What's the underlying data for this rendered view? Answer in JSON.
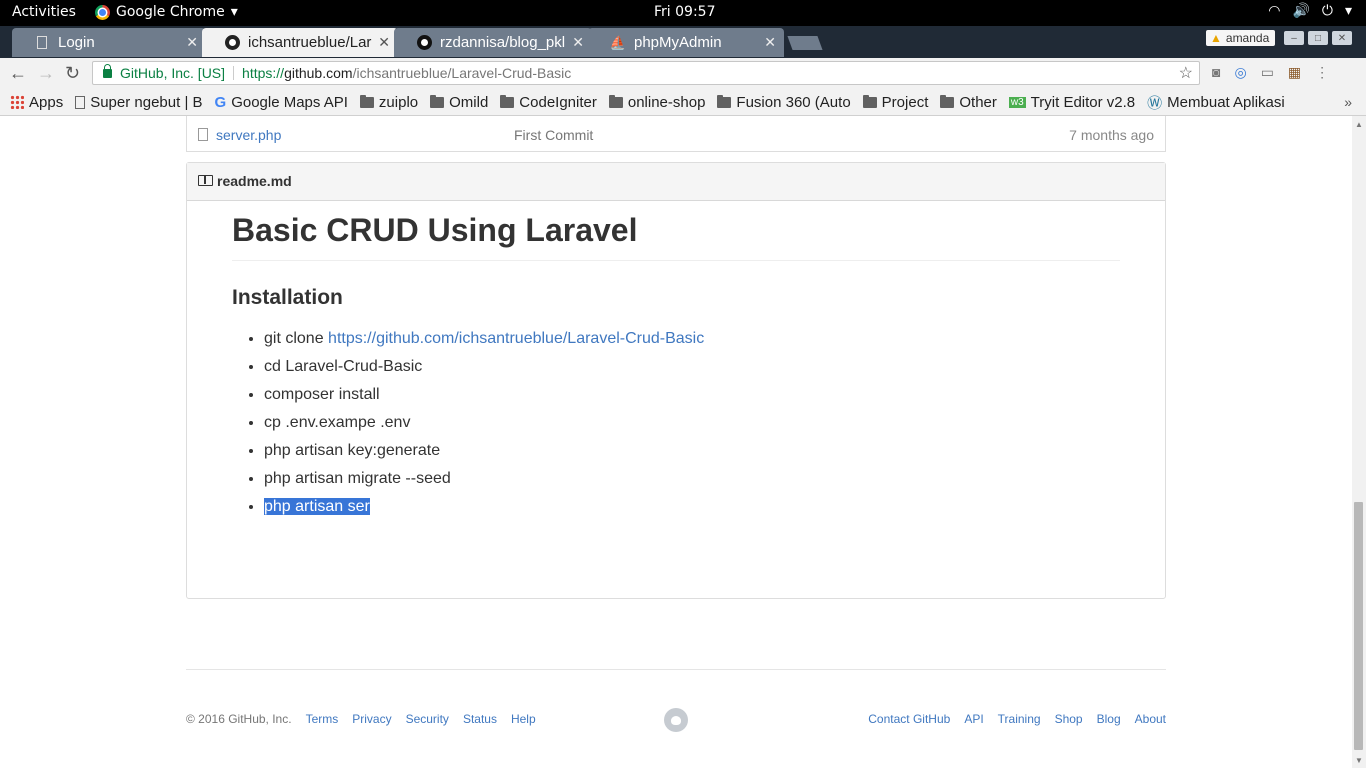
{
  "system_bar": {
    "activities": "Activities",
    "app_name": "Google Chrome",
    "clock": "Fri 09:57"
  },
  "tabs": [
    {
      "title": "Login",
      "active": false
    },
    {
      "title": "ichsantrueblue/Lara",
      "active": true
    },
    {
      "title": "rzdannisa/blog_pkl",
      "active": false
    },
    {
      "title": "phpMyAdmin",
      "active": false
    }
  ],
  "profile": {
    "name": "amanda"
  },
  "address_bar": {
    "ev_label": "GitHub, Inc. [US]",
    "url_protocol": "https://",
    "url_host": "github.com",
    "url_path": "/ichsantrueblue/Laravel-Crud-Basic"
  },
  "bookmarks": [
    {
      "label": "Apps",
      "icon": "apps-icon"
    },
    {
      "label": "Super ngebut | B",
      "icon": "page-icon"
    },
    {
      "label": "Google Maps API",
      "icon": "google-icon"
    },
    {
      "label": "zuiplo",
      "icon": "folder-icon"
    },
    {
      "label": "Omild",
      "icon": "folder-icon"
    },
    {
      "label": "CodeIgniter",
      "icon": "folder-icon"
    },
    {
      "label": "online-shop",
      "icon": "folder-icon"
    },
    {
      "label": "Fusion 360 (Auto",
      "icon": "folder-icon"
    },
    {
      "label": "Project",
      "icon": "folder-icon"
    },
    {
      "label": "Other",
      "icon": "folder-icon"
    },
    {
      "label": "Tryit Editor v2.8",
      "icon": "w3-icon"
    },
    {
      "label": "Membuat Aplikasi",
      "icon": "wordpress-icon"
    }
  ],
  "file_row": {
    "name": "server.php",
    "message": "First Commit",
    "age": "7 months ago"
  },
  "readme": {
    "filename": "readme.md",
    "title": "Basic CRUD Using Laravel",
    "subtitle": "Installation",
    "steps": {
      "step1_prefix": "git clone ",
      "step1_link": "https://github.com/ichsantrueblue/Laravel-Crud-Basic",
      "step2": "cd Laravel-Crud-Basic",
      "step3": "composer install",
      "step4": "cp .env.exampe .env",
      "step5": "php artisan key:generate",
      "step6": "php artisan migrate --seed",
      "step7": "php artisan ser"
    }
  },
  "footer": {
    "copyright": "© 2016 GitHub, Inc.",
    "left_links": [
      "Terms",
      "Privacy",
      "Security",
      "Status",
      "Help"
    ],
    "right_links": [
      "Contact GitHub",
      "API",
      "Training",
      "Shop",
      "Blog",
      "About"
    ]
  },
  "colors": {
    "link": "#4078c0",
    "selection": "#3875d7",
    "secure_green": "#0b8043"
  }
}
